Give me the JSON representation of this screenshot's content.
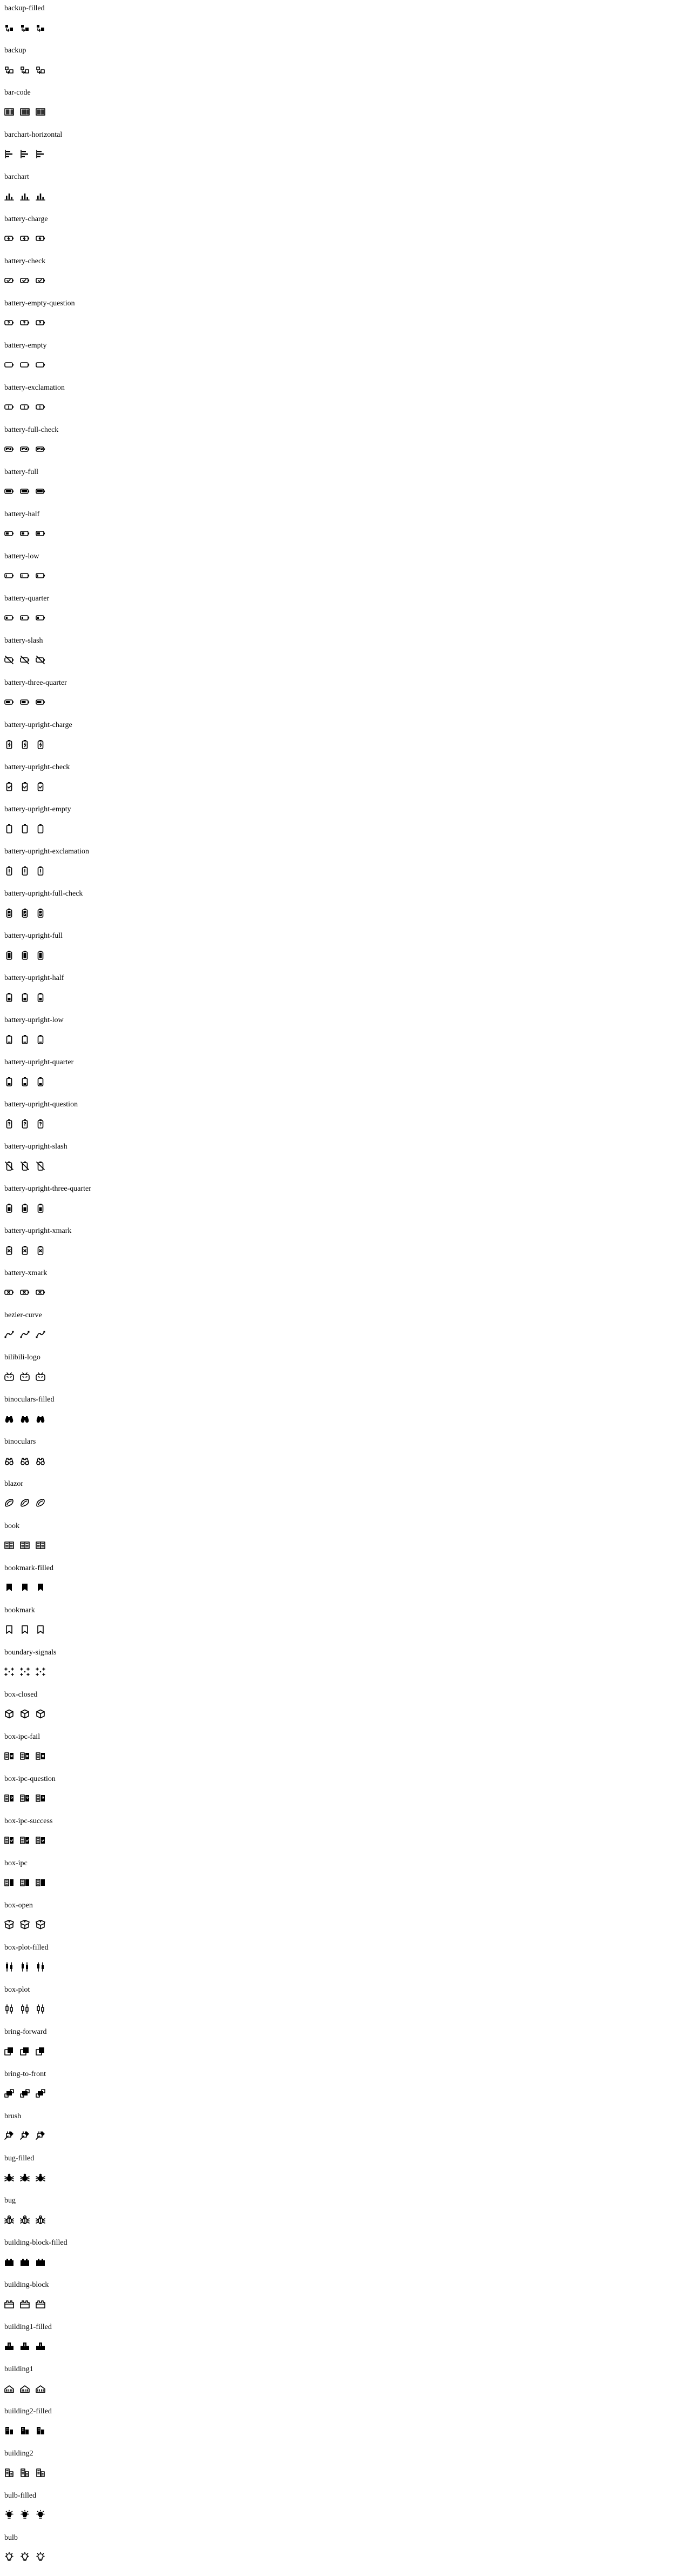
{
  "icons": [
    {
      "label": "backup-filled",
      "glyph": "backup-filled"
    },
    {
      "label": "backup",
      "glyph": "backup"
    },
    {
      "label": "bar-code",
      "glyph": "bar-code"
    },
    {
      "label": "barchart-horizontal",
      "glyph": "barchart-horizontal"
    },
    {
      "label": "barchart",
      "glyph": "barchart"
    },
    {
      "label": "battery-charge",
      "glyph": "battery-charge"
    },
    {
      "label": "battery-check",
      "glyph": "battery-check"
    },
    {
      "label": "battery-empty-question",
      "glyph": "battery-empty-question"
    },
    {
      "label": "battery-empty",
      "glyph": "battery-empty"
    },
    {
      "label": "battery-exclamation",
      "glyph": "battery-exclamation"
    },
    {
      "label": "battery-full-check",
      "glyph": "battery-full-check"
    },
    {
      "label": "battery-full",
      "glyph": "battery-full"
    },
    {
      "label": "battery-half",
      "glyph": "battery-half"
    },
    {
      "label": "battery-low",
      "glyph": "battery-low"
    },
    {
      "label": "battery-quarter",
      "glyph": "battery-quarter"
    },
    {
      "label": "battery-slash",
      "glyph": "battery-slash"
    },
    {
      "label": "battery-three-quarter",
      "glyph": "battery-three-quarter"
    },
    {
      "label": "battery-upright-charge",
      "glyph": "battery-upright-charge"
    },
    {
      "label": "battery-upright-check",
      "glyph": "battery-upright-check"
    },
    {
      "label": "battery-upright-empty",
      "glyph": "battery-upright-empty"
    },
    {
      "label": "battery-upright-exclamation",
      "glyph": "battery-upright-exclamation"
    },
    {
      "label": "battery-upright-full-check",
      "glyph": "battery-upright-full-check"
    },
    {
      "label": "battery-upright-full",
      "glyph": "battery-upright-full"
    },
    {
      "label": "battery-upright-half",
      "glyph": "battery-upright-half"
    },
    {
      "label": "battery-upright-low",
      "glyph": "battery-upright-low"
    },
    {
      "label": "battery-upright-quarter",
      "glyph": "battery-upright-quarter"
    },
    {
      "label": "battery-upright-question",
      "glyph": "battery-upright-question"
    },
    {
      "label": "battery-upright-slash",
      "glyph": "battery-upright-slash"
    },
    {
      "label": "battery-upright-three-quarter",
      "glyph": "battery-upright-three-quarter"
    },
    {
      "label": "battery-upright-xmark",
      "glyph": "battery-upright-xmark"
    },
    {
      "label": "battery-xmark",
      "glyph": "battery-xmark"
    },
    {
      "label": "bezier-curve",
      "glyph": "bezier-curve"
    },
    {
      "label": "bilibili-logo",
      "glyph": "bilibili-logo"
    },
    {
      "label": "binoculars-filled",
      "glyph": "binoculars-filled"
    },
    {
      "label": "binoculars",
      "glyph": "binoculars"
    },
    {
      "label": "blazor",
      "glyph": "blazor"
    },
    {
      "label": "book",
      "glyph": "book"
    },
    {
      "label": "bookmark-filled",
      "glyph": "bookmark-filled"
    },
    {
      "label": "bookmark",
      "glyph": "bookmark"
    },
    {
      "label": "boundary-signals",
      "glyph": "boundary-signals"
    },
    {
      "label": "box-closed",
      "glyph": "box-closed"
    },
    {
      "label": "box-ipc-fail",
      "glyph": "box-ipc-fail"
    },
    {
      "label": "box-ipc-question",
      "glyph": "box-ipc-question"
    },
    {
      "label": "box-ipc-success",
      "glyph": "box-ipc-success"
    },
    {
      "label": "box-ipc",
      "glyph": "box-ipc"
    },
    {
      "label": "box-open",
      "glyph": "box-open"
    },
    {
      "label": "box-plot-filled",
      "glyph": "box-plot-filled"
    },
    {
      "label": "box-plot",
      "glyph": "box-plot"
    },
    {
      "label": "bring-forward",
      "glyph": "bring-forward"
    },
    {
      "label": "bring-to-front",
      "glyph": "bring-to-front"
    },
    {
      "label": "brush",
      "glyph": "brush"
    },
    {
      "label": "bug-filled",
      "glyph": "bug-filled"
    },
    {
      "label": "bug",
      "glyph": "bug"
    },
    {
      "label": "building-block-filled",
      "glyph": "building-block-filled"
    },
    {
      "label": "building-block",
      "glyph": "building-block"
    },
    {
      "label": "building1-filled",
      "glyph": "building1-filled"
    },
    {
      "label": "building1",
      "glyph": "building1"
    },
    {
      "label": "building2-filled",
      "glyph": "building2-filled"
    },
    {
      "label": "building2",
      "glyph": "building2"
    },
    {
      "label": "bulb-filled",
      "glyph": "bulb-filled"
    },
    {
      "label": "bulb",
      "glyph": "bulb"
    }
  ],
  "variants_per_icon": 3,
  "colors": {
    "background": "#ffffff",
    "text": "#000000",
    "icon": "#000000"
  }
}
